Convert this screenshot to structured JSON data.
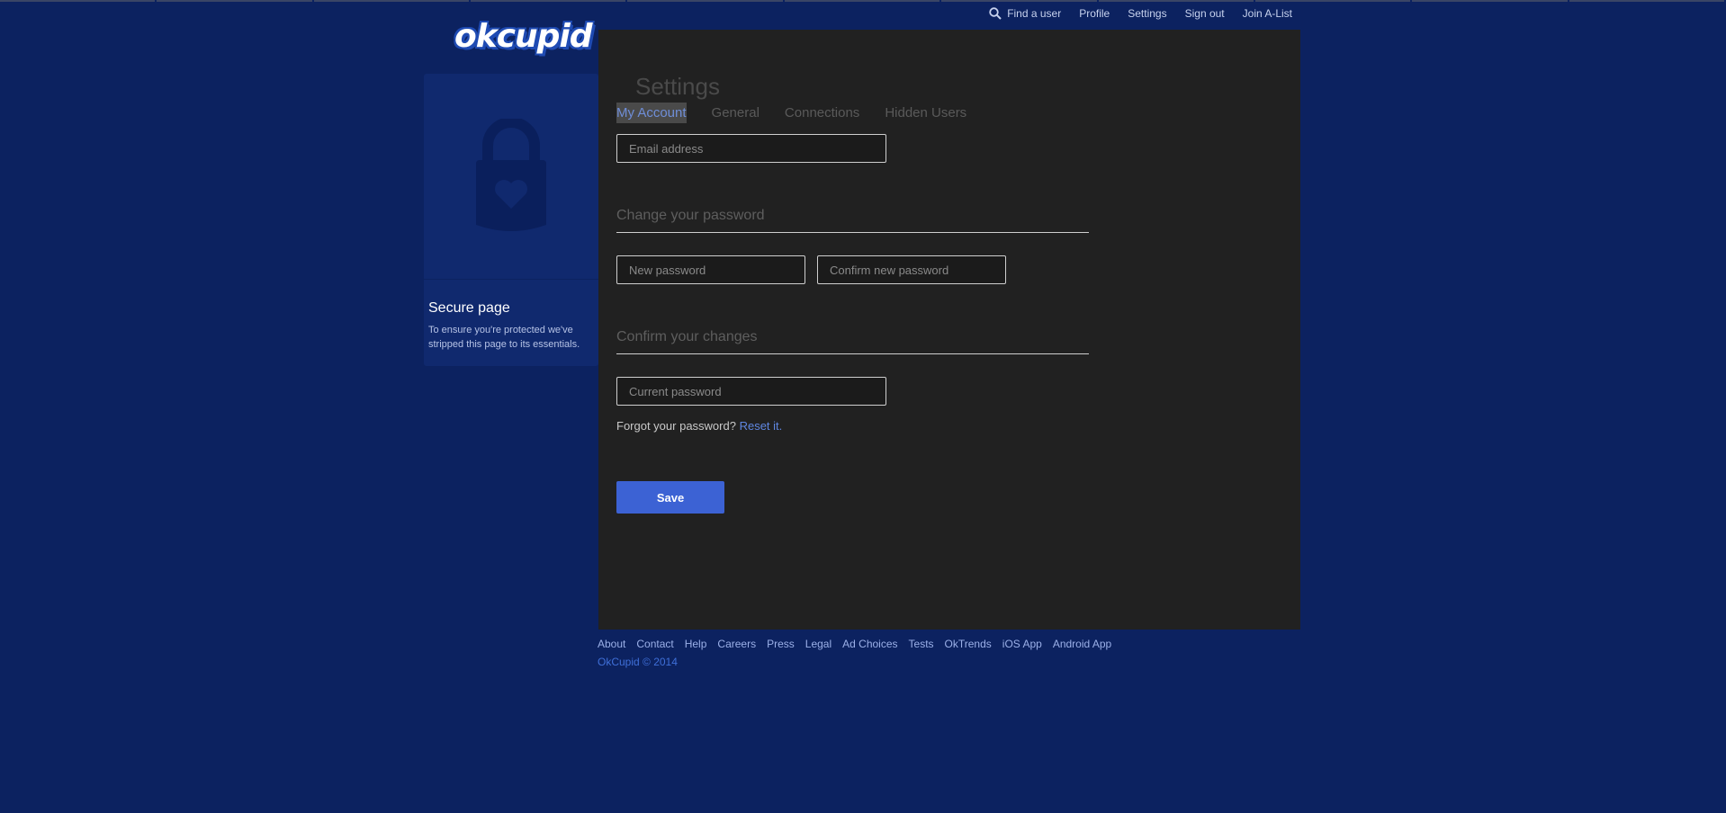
{
  "brand": {
    "logo": "okcupid",
    "accent": "#3c62d4",
    "background": "#0c2260"
  },
  "topnav": {
    "find_user": "Find a user",
    "find_icon": "search-icon",
    "profile": "Profile",
    "settings": "Settings",
    "sign_out": "Sign out",
    "join": "Join A-List"
  },
  "sidebar": {
    "icon": "lock-heart-icon",
    "title": "Secure page",
    "description": "To ensure you're protected we've stripped this page to its essentials."
  },
  "settings": {
    "title": "Settings",
    "tabs": [
      {
        "label": "My Account",
        "active": true
      },
      {
        "label": "General",
        "active": false
      },
      {
        "label": "Connections",
        "active": false
      },
      {
        "label": "Hidden Users",
        "active": false
      }
    ],
    "email_placeholder": "Email address",
    "change_password_title": "Change your password",
    "new_password_placeholder": "New password",
    "confirm_password_placeholder": "Confirm new password",
    "confirm_changes_title": "Confirm your changes",
    "current_password_placeholder": "Current password",
    "forgot_text": "Forgot your password?",
    "reset_link": "Reset it.",
    "save_label": "Save"
  },
  "footer": {
    "links": [
      "About",
      "Contact",
      "Help",
      "Careers",
      "Press",
      "Legal",
      "Ad Choices",
      "Tests",
      "OkTrends",
      "iOS App",
      "Android App"
    ],
    "copyright": "OkCupid © 2014"
  }
}
